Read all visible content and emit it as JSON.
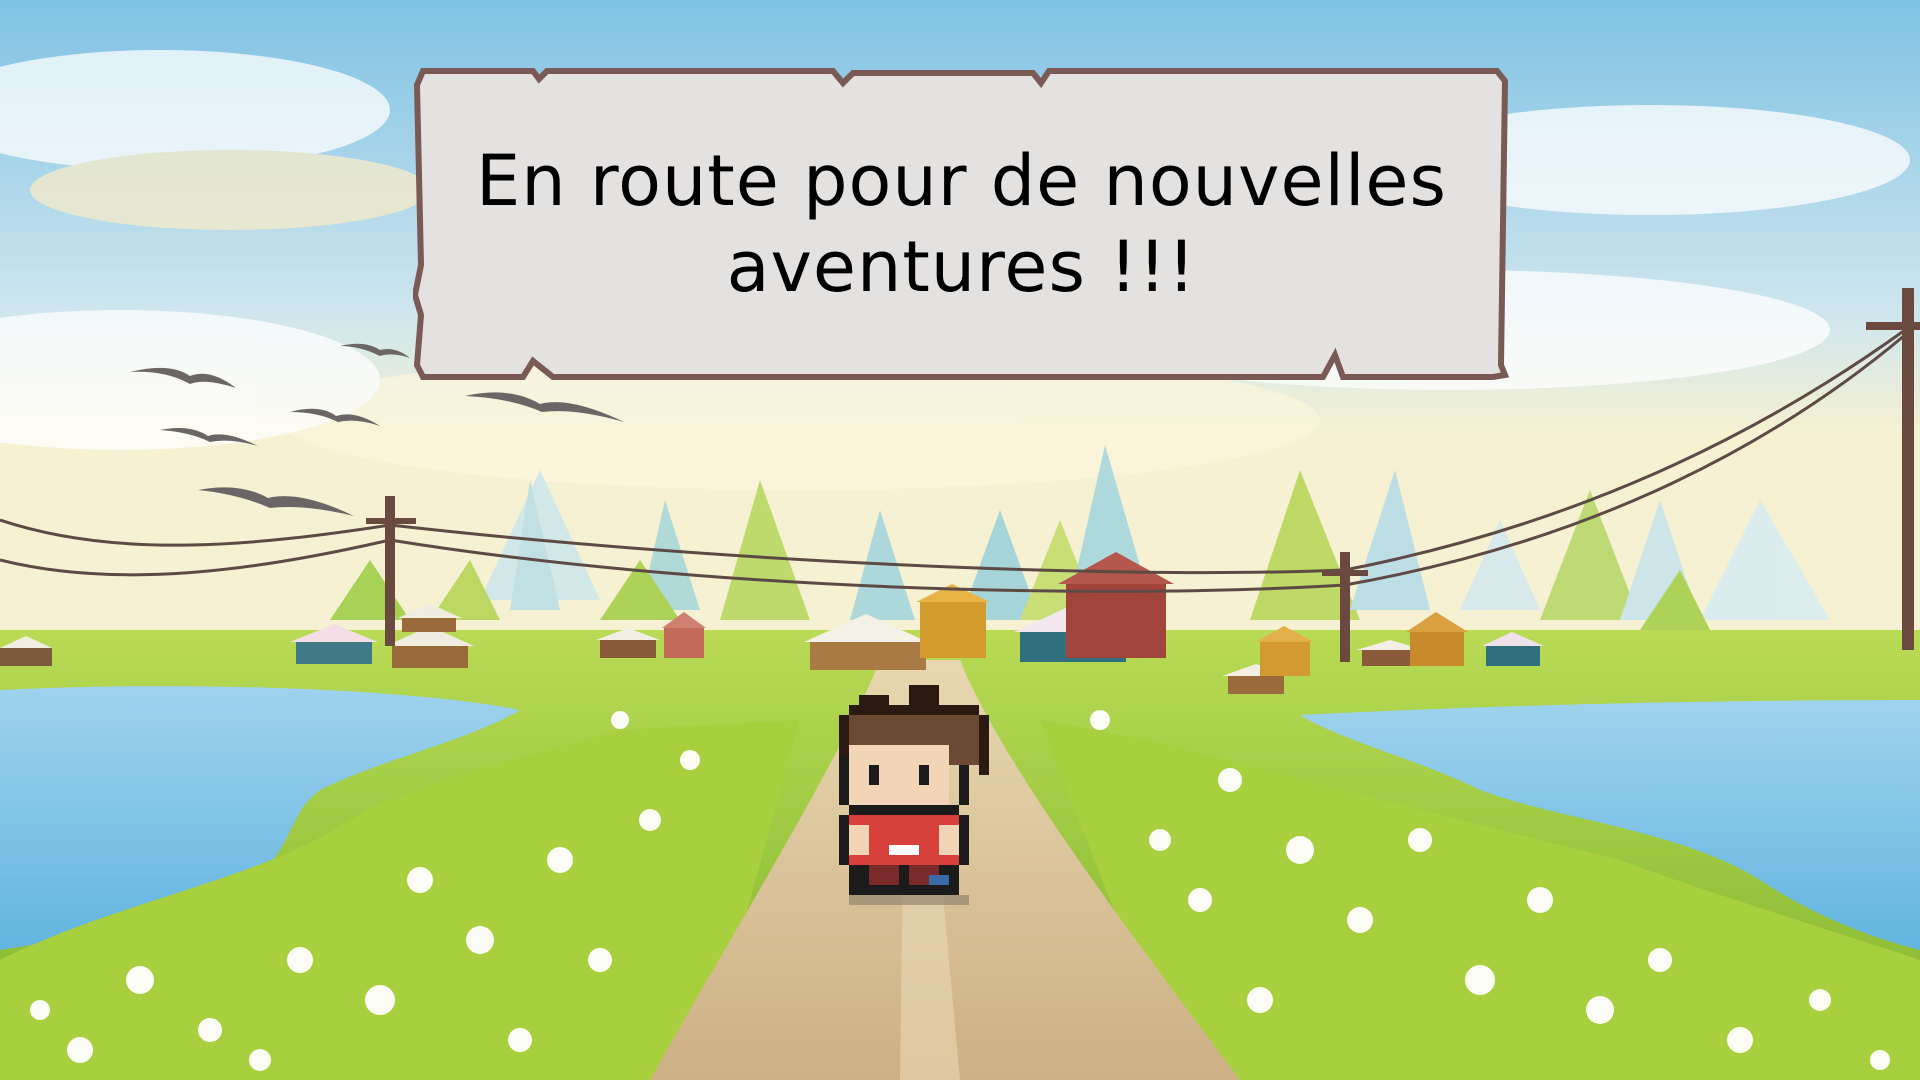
{
  "dialog": {
    "line1": "En route pour de nouvelles",
    "line2": "aventures !!!"
  },
  "scene": {
    "character": "pixel-hero",
    "setting": "village-road"
  },
  "colors": {
    "sky_top": "#8fc8e6",
    "sky_bottom": "#f6f3dc",
    "grass": "#9cc93a",
    "water": "#7cc3e4",
    "road": "#dcc39a",
    "dialog_fill": "#e4e1e1",
    "dialog_border": "#7a5a55"
  }
}
